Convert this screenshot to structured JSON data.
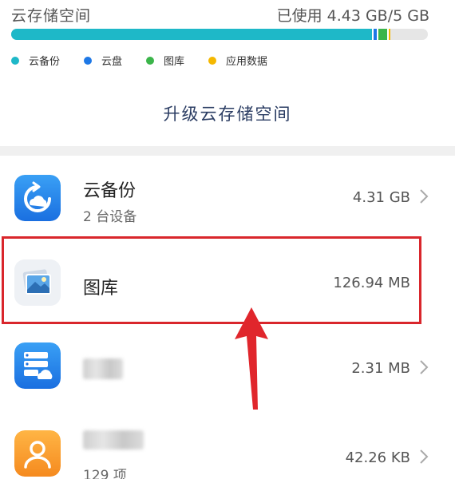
{
  "storage": {
    "title": "云存储空间",
    "usage": "已使用 4.43 GB/5 GB",
    "upgrade_label": "升级云存储空间",
    "segments": [
      {
        "key": "backup",
        "fraction": 0.866,
        "color": "#1eb8c8"
      },
      {
        "key": "drive",
        "fraction": 0.008,
        "color": "#1e78e6"
      },
      {
        "key": "gallery",
        "fraction": 0.02,
        "color": "#3bb54a"
      },
      {
        "key": "appdata",
        "fraction": 0.004,
        "color": "#f5b800"
      }
    ],
    "legend": [
      {
        "label": "云备份",
        "color": "#1eb8c8"
      },
      {
        "label": "云盘",
        "color": "#1e78e6"
      },
      {
        "label": "图库",
        "color": "#3bb54a"
      },
      {
        "label": "应用数据",
        "color": "#f5b800"
      }
    ]
  },
  "list": {
    "items": [
      {
        "name": "云备份",
        "subtitle": "2 台设备",
        "size": "4.31 GB",
        "icon": "cloud-backup-icon"
      },
      {
        "name": "图库",
        "subtitle": "",
        "size": "126.94 MB",
        "icon": "gallery-icon"
      },
      {
        "name": "",
        "subtitle": "",
        "size": "2.31 MB",
        "icon": "drive-icon"
      },
      {
        "name": "",
        "subtitle": "129 项",
        "size": "42.26 KB",
        "icon": "contacts-icon"
      }
    ]
  },
  "annotation": {
    "highlight_color": "#d9262c"
  }
}
